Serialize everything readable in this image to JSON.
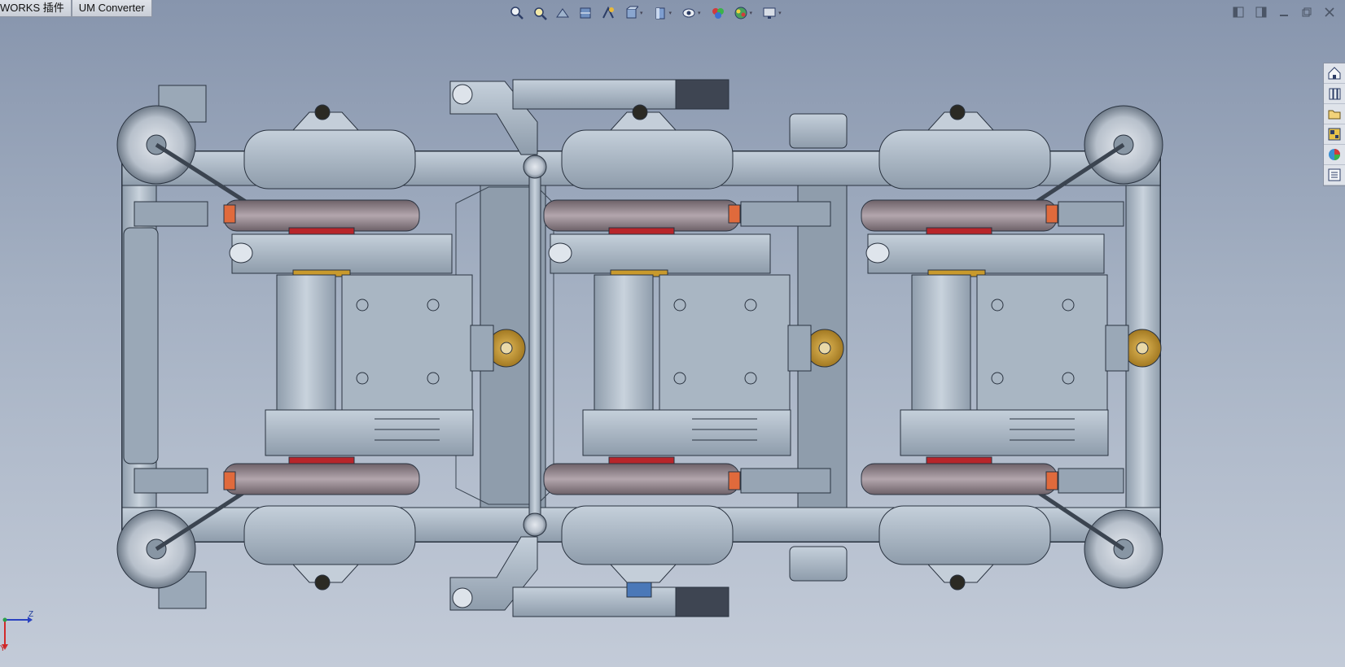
{
  "tabs": [
    {
      "label": "WORKS 插件"
    },
    {
      "label": "UM Converter"
    }
  ],
  "hud_toolbar": {
    "items": [
      "zoom-to-fit-icon",
      "zoom-to-area-icon",
      "previous-view-icon",
      "section-view-icon",
      "dynamic-annotation-icon",
      "view-orientation-icon",
      "display-style-icon",
      "hide-show-items-icon",
      "edit-appearance-icon",
      "apply-scene-icon",
      "view-settings-icon"
    ]
  },
  "window_controls": [
    "tile-left-icon",
    "tile-right-icon",
    "minimize-icon",
    "restore-icon",
    "close-icon"
  ],
  "task_pane": [
    "home-icon",
    "design-library-icon",
    "file-explorer-icon",
    "view-palette-icon",
    "appearances-icon",
    "custom-properties-icon"
  ],
  "triad": {
    "axis_z": "Z",
    "axis_y": "Y"
  },
  "colors": {
    "steel": "#a9b6c3",
    "steel_dark": "#7d8b99",
    "brake_red": "#b8252a",
    "bushing_orange": "#e06a3c",
    "bronze": "#c99a2c"
  }
}
